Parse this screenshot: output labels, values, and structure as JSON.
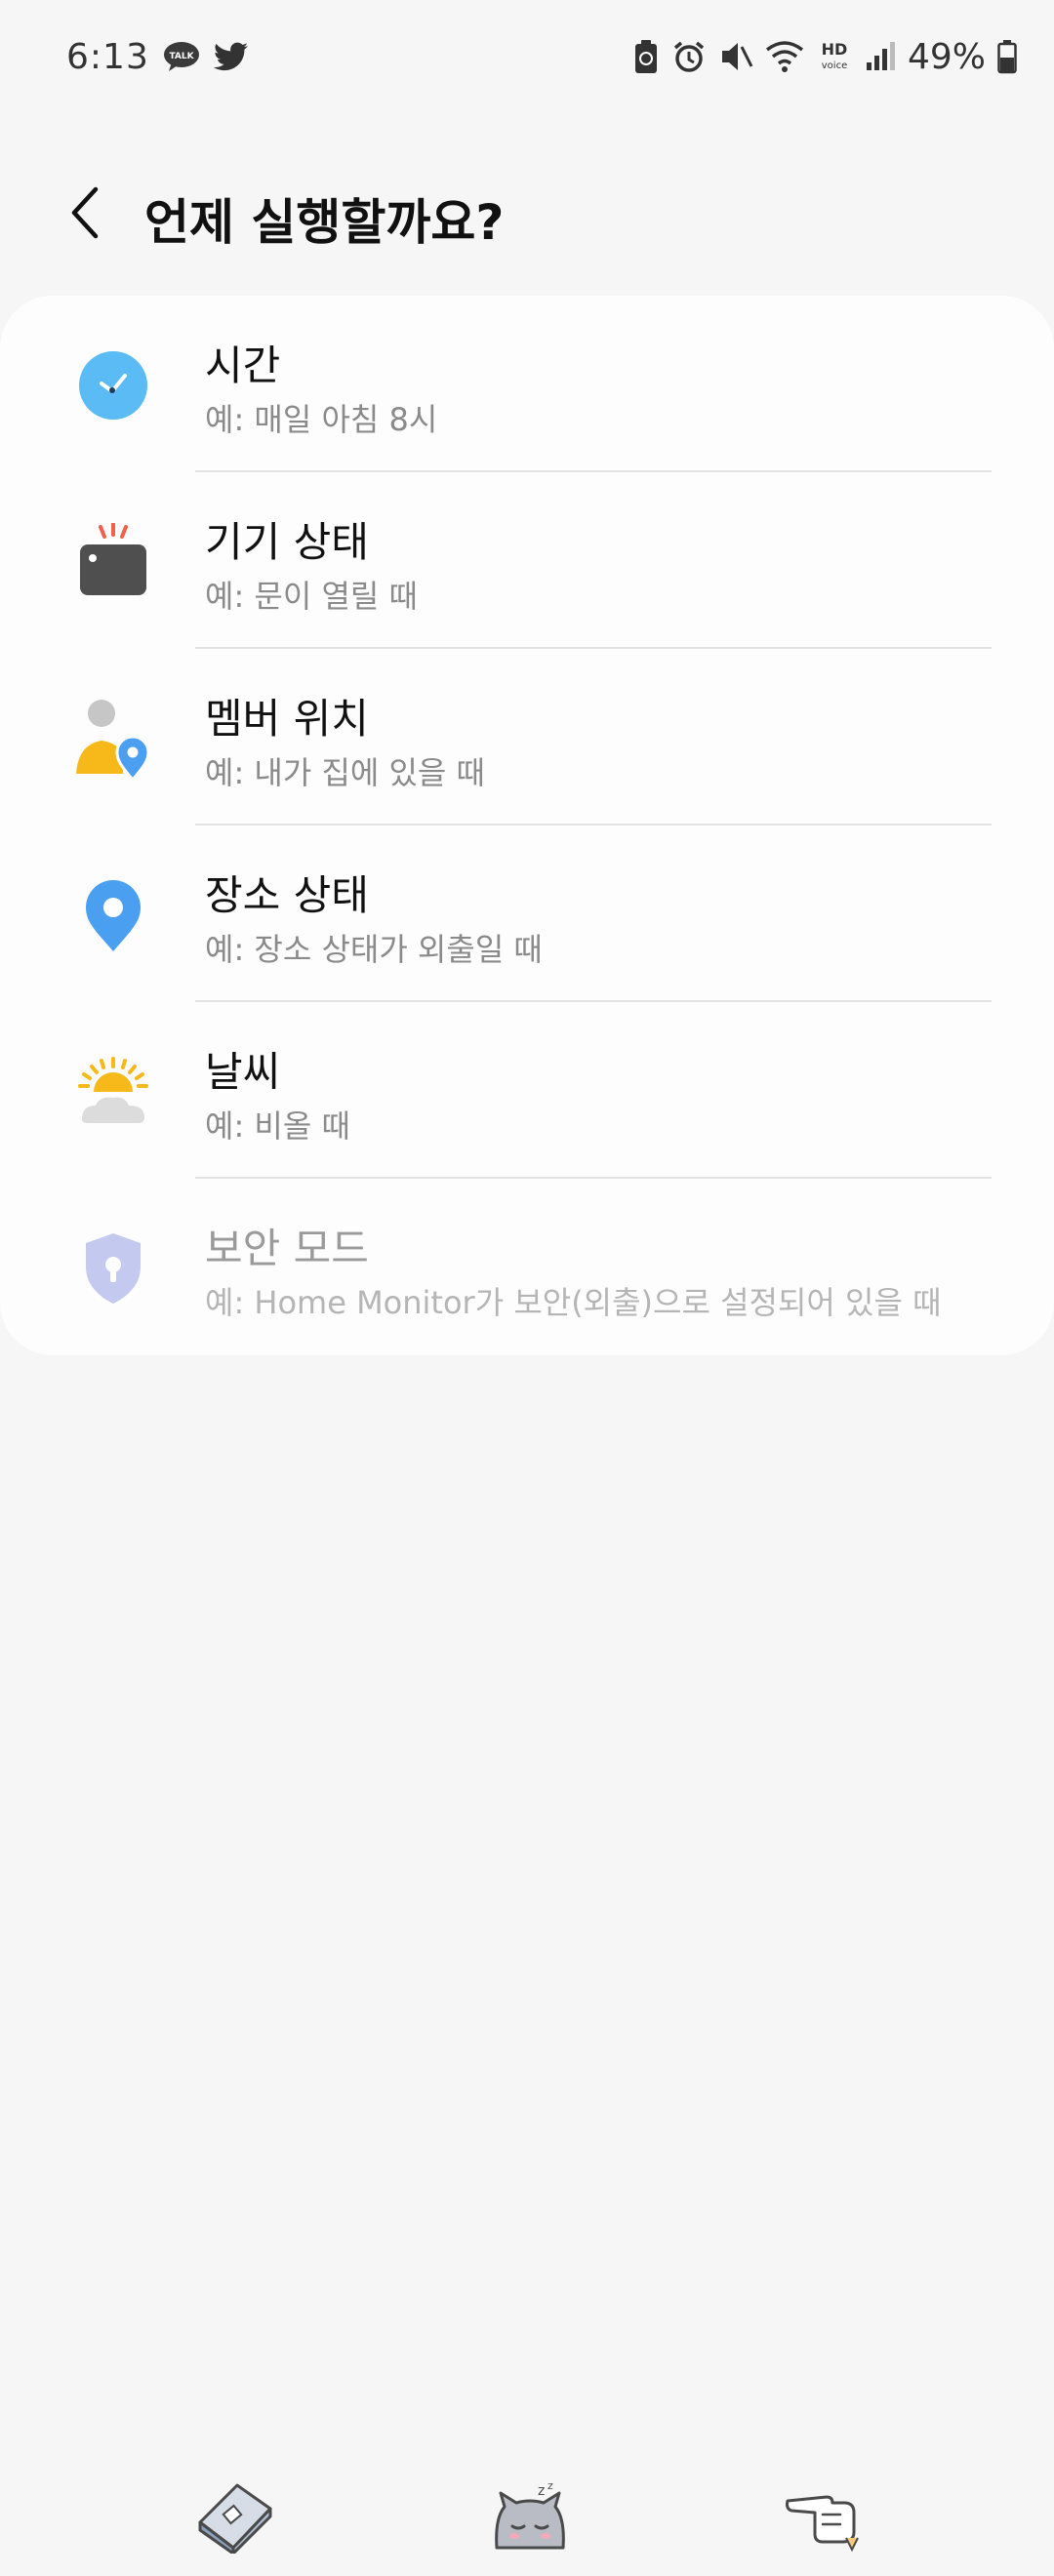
{
  "status_bar": {
    "time": "6:13",
    "left_icons": [
      "kakaotalk-icon",
      "twitter-icon"
    ],
    "right_icons": [
      "battery-saver-icon",
      "alarm-icon",
      "mute-icon",
      "wifi-icon",
      "hd-voice-icon",
      "signal-icon"
    ],
    "battery": "49%",
    "kakaotalk_label": "TALK",
    "hd_label": "HD",
    "voice_label": "voice"
  },
  "header": {
    "back_icon": "chevron-left-icon",
    "title": "언제 실행할까요?"
  },
  "options": [
    {
      "title": "시간",
      "subtitle": "예: 매일 아침 8시",
      "icon": "clock-icon",
      "enabled": true
    },
    {
      "title": "기기 상태",
      "subtitle": "예: 문이 열릴 때",
      "icon": "device-icon",
      "enabled": true
    },
    {
      "title": "멤버 위치",
      "subtitle": "예: 내가 집에 있을 때",
      "icon": "member-location-icon",
      "enabled": true
    },
    {
      "title": "장소 상태",
      "subtitle": "예: 장소 상태가 외출일 때",
      "icon": "location-pin-icon",
      "enabled": true
    },
    {
      "title": "날씨",
      "subtitle": "예: 비올 때",
      "icon": "weather-icon",
      "enabled": true
    },
    {
      "title": "보안 모드",
      "subtitle": "예: Home Monitor가 보안(외출)으로 설정되어 있을 때",
      "icon": "security-shield-icon",
      "enabled": false
    }
  ],
  "colors": {
    "background": "#f6f6f6",
    "card": "#fdfdfd",
    "clock_blue": "#5bbcf5",
    "pin_blue": "#4a9ff0",
    "member_yellow": "#f7b81a",
    "sun_yellow": "#f7b81a",
    "shield_lavender": "#c3c9ef",
    "device_dark": "#4f4f4f",
    "device_red": "#f0604a"
  },
  "bottom_bar": {
    "icons": [
      "book-sticker-icon",
      "sleeping-cat-sticker-icon",
      "pointing-hand-sticker-icon"
    ]
  }
}
